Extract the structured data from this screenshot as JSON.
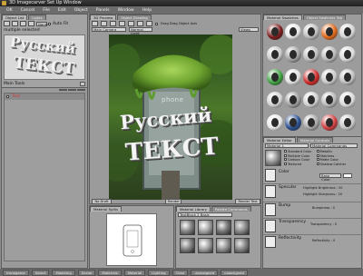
{
  "app": {
    "title": "3D Imagecarver Set Up Window"
  },
  "menu": [
    "OK",
    "Cancel",
    "File",
    "Edit",
    "Object",
    "Panels",
    "Window",
    "Help"
  ],
  "left_tabs": [
    "Object List",
    "Lights"
  ],
  "left_panel": {
    "display_label": "Normal",
    "auto_fit_label": "Auto Fit",
    "selected_text": "multiple  selected",
    "preview_line1": "Русский",
    "preview_line2": "ТЕКСТ",
    "tool_label": "Main Tools",
    "layer_item": "Text"
  },
  "center_tabs": [
    "3D Preview",
    "Object Drawing"
  ],
  "viewport": {
    "camera_label": "Main Camera",
    "light_label": "Normal Light",
    "view_label": "Views",
    "drag_label": "Drag Drag Object Axis",
    "sign_text": "phone",
    "text_line1": "Русский",
    "text_line2": "ТЕКСТ",
    "bottom_left": "No Draft",
    "bottom_right": "Render Test",
    "bottom_mid": "Render"
  },
  "right_tabs": [
    "Material Swatches",
    "Object Swatches Tab"
  ],
  "ring_colors": [
    [
      "#7b1c1c",
      "#e6e6e6",
      "#bdbdbd",
      "#e06a1a",
      "#d4d4d4"
    ],
    [
      "#c8c8c8",
      "#a0a0a0",
      "#bcbcbc",
      "#b6b6b6",
      "#d9d9d9"
    ],
    [
      "#3fa142",
      "#e0e0e0",
      "#cc2b2b",
      "#c9c9c9",
      "#bfbfbf"
    ],
    [
      "#d3d3d3",
      "#9e9e9e",
      "#cfcfcf",
      "#b7b7b7",
      "#dadada"
    ],
    [
      "#e8e8e8",
      "#2a4f8f",
      "#a7a7a7",
      "#d04040",
      "#c7c7c7"
    ]
  ],
  "material_editor": {
    "tabs": [
      "Material Editor",
      "Material Controls"
    ],
    "material_name": "Material 1",
    "material_dropdown": "Material Commands",
    "checkbox_items": [
      "Standard Color",
      "Metallic",
      "Multiple Color",
      "Stainless",
      "Cartoon Color",
      "Matte Color",
      "Textured",
      "Shadow Catcher"
    ],
    "rows": [
      {
        "label": "Color",
        "detail": "Base Color"
      },
      {
        "label": "Specular",
        "detail": "Highlight Sharpness : 20"
      },
      {
        "label": "Bump",
        "detail": "Bumpiness : 0"
      },
      {
        "label": "Transparency",
        "detail": "Transparency : 0"
      },
      {
        "label": "Reflectivity",
        "detail": "Reflectivity : 0"
      }
    ],
    "detail_extra": "Highlight Brightness : 20"
  },
  "bottom_left_tabs": [
    "Material Splits"
  ],
  "bottom_center_tabs": [
    "Material Library",
    "Palette Commands"
  ],
  "bottom_center_label": "TextBlock 2 Basic",
  "statusbar": [
    "Intralgame",
    "Select",
    "Modeling",
    "Scene",
    "Materials",
    "Material",
    "Lighting",
    "Clear",
    "unassigned",
    "unassigned"
  ],
  "colors": {
    "accent": "#d53535",
    "panel": "#a3a3a3",
    "moss": "#5f9c2e"
  }
}
